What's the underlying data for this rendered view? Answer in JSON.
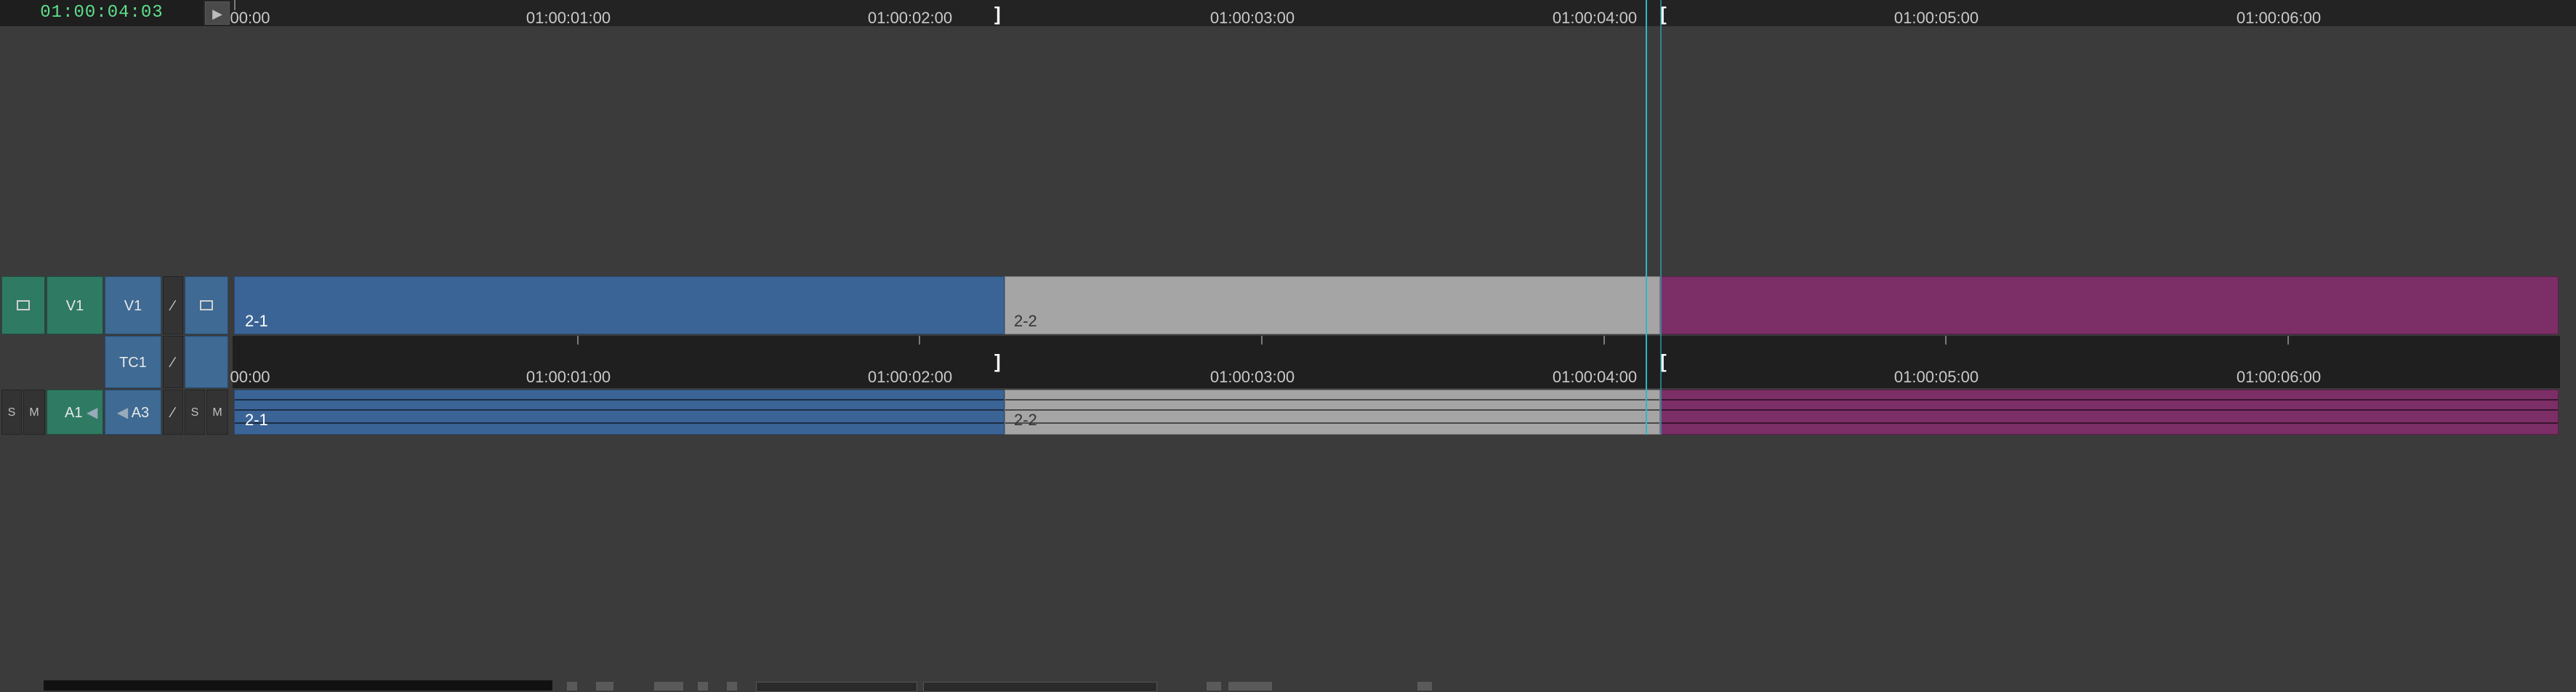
{
  "timecode": {
    "current": "01:00:04:03"
  },
  "ruler": {
    "labels": [
      "00:00",
      "01:00:01:00",
      "01:00:02:00",
      "01:00:03:00",
      "01:00:04:00",
      "01:00:05:00",
      "01:00:06:00"
    ]
  },
  "tracks": {
    "video": {
      "source_label": "V1",
      "record_label": "V1"
    },
    "timecode": {
      "record_label": "TC1"
    },
    "audio": {
      "solo_label": "S",
      "mute_label": "M",
      "source_label": "A1",
      "record_label": "A3",
      "solo2_label": "S",
      "mute2_label": "M"
    }
  },
  "clips": {
    "video": [
      {
        "name": "2-1",
        "color": "#3b6496"
      },
      {
        "name": "2-2",
        "color": "#a5a5a5"
      },
      {
        "name": "",
        "color": "#7c2e66"
      }
    ],
    "audio": [
      {
        "name": "2-1",
        "color": "#3b6496"
      },
      {
        "name": "2-2",
        "color": "#a5a5a5"
      },
      {
        "name": "",
        "color": "#7c2e66"
      }
    ]
  },
  "colors": {
    "playhead": "#2fb6c8",
    "timecode_text": "#5fe08c"
  }
}
